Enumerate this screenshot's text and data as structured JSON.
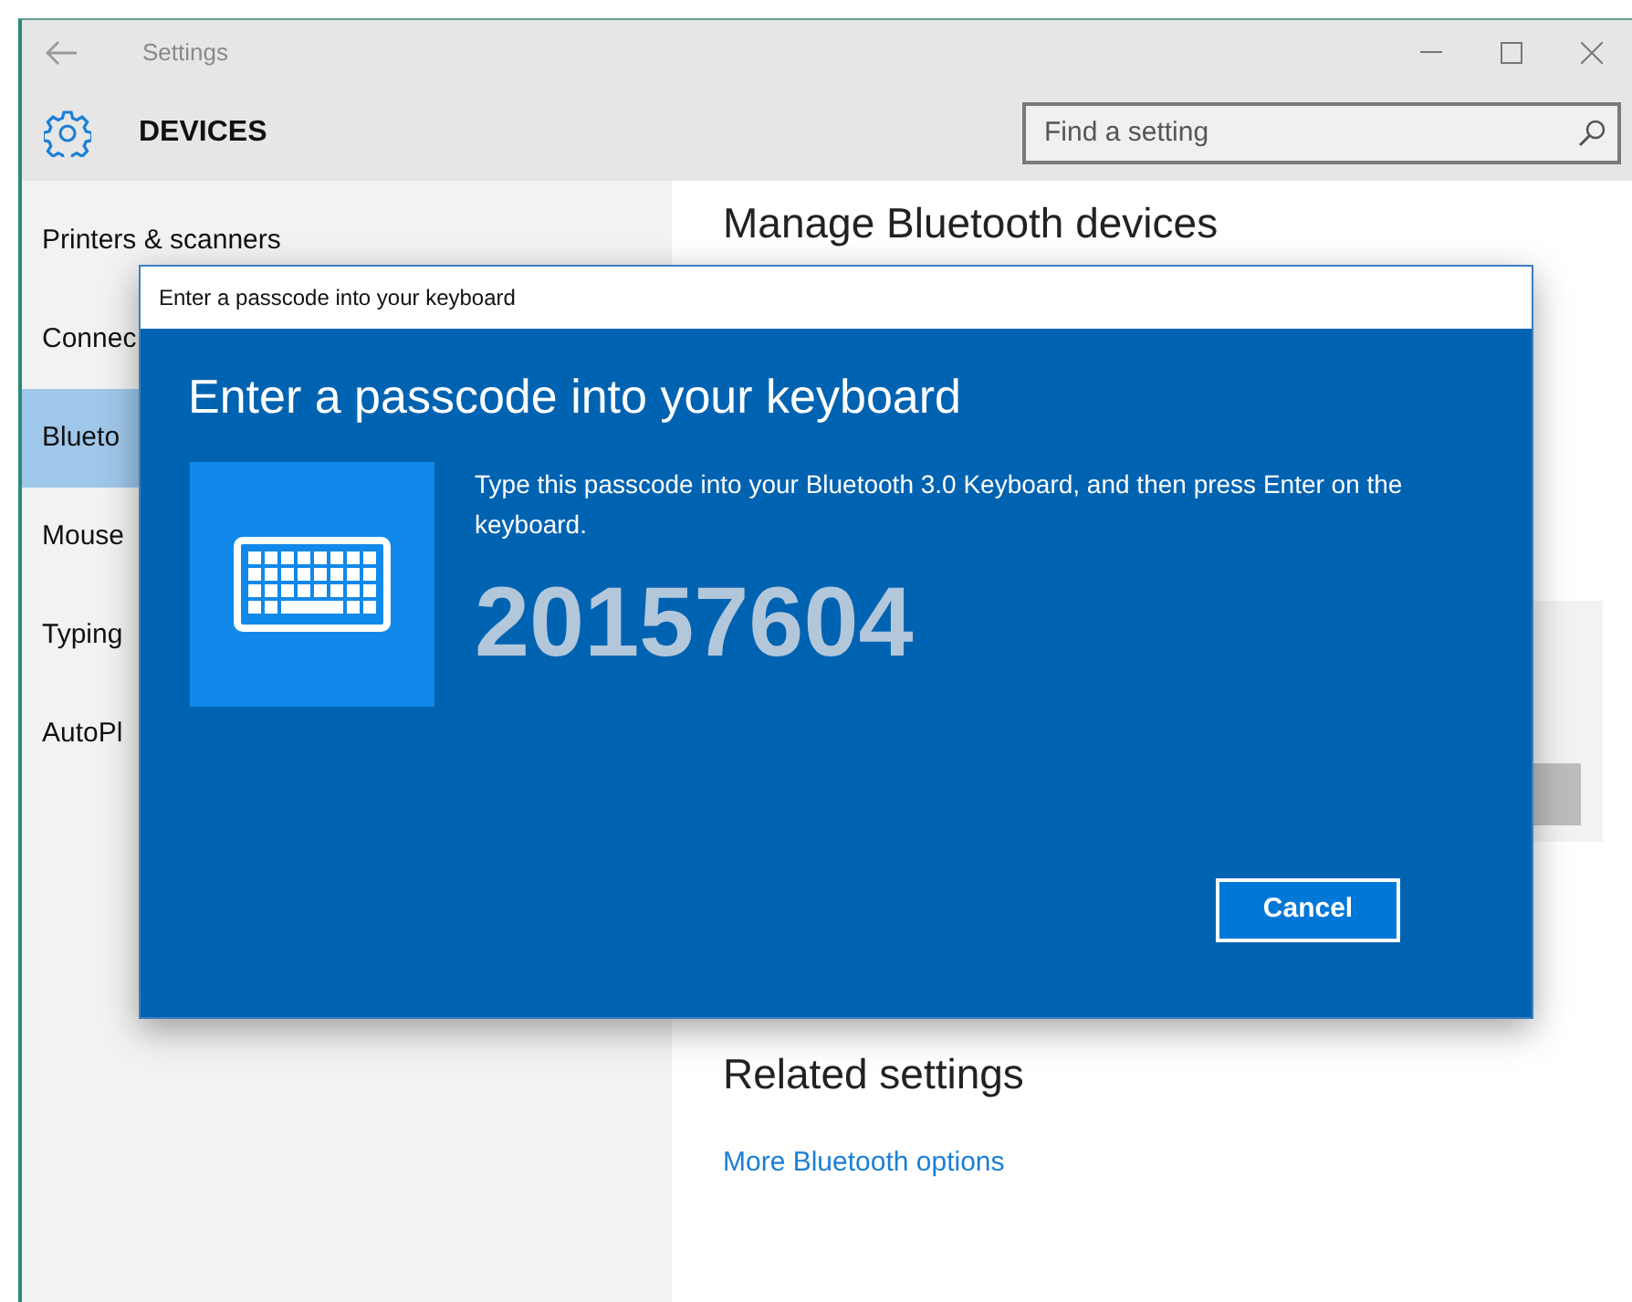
{
  "window": {
    "title": "Settings"
  },
  "header": {
    "title": "DEVICES",
    "search": {
      "placeholder": "Find a setting"
    }
  },
  "sidebar": {
    "items": [
      {
        "label": "Printers & scanners",
        "selected": false
      },
      {
        "label": "Connec",
        "selected": false
      },
      {
        "label": "Blueto",
        "selected": true
      },
      {
        "label": "Mouse",
        "selected": false
      },
      {
        "label": "Typing",
        "selected": false
      },
      {
        "label": "AutoPl",
        "selected": false
      }
    ]
  },
  "content": {
    "heading": "Manage Bluetooth devices",
    "related_heading": "Related settings",
    "link": "More Bluetooth options"
  },
  "dialog": {
    "title": "Enter a passcode into your keyboard",
    "heading": "Enter a passcode into your keyboard",
    "message": "Type this passcode into your Bluetooth 3.0 Keyboard, and then press Enter on the keyboard.",
    "passcode": "20157604",
    "button": "Cancel"
  }
}
